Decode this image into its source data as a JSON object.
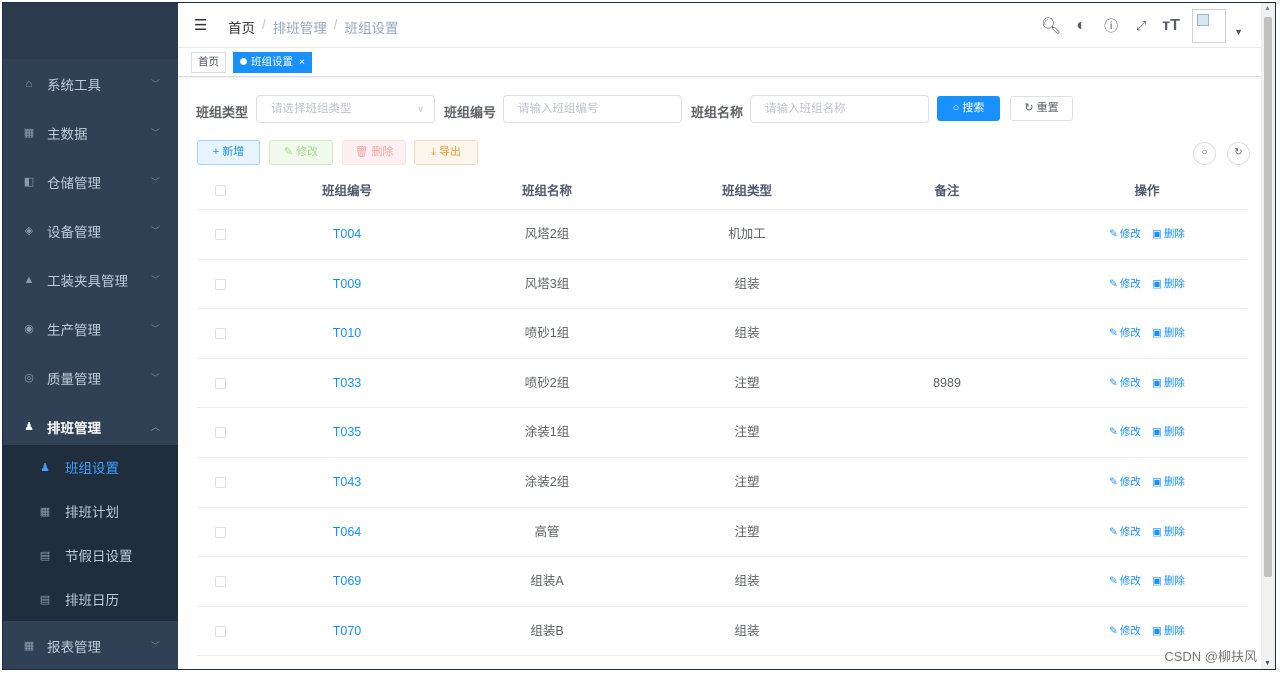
{
  "sidebar": {
    "items": [
      {
        "label": "系统工具",
        "icon": "toolbox-icon",
        "glyph": "⌂"
      },
      {
        "label": "主数据",
        "icon": "grid-icon",
        "glyph": "▦"
      },
      {
        "label": "仓储管理",
        "icon": "warehouse-icon",
        "glyph": "◧"
      },
      {
        "label": "设备管理",
        "icon": "layers-icon",
        "glyph": "◈"
      },
      {
        "label": "工装夹具管理",
        "icon": "lock-icon",
        "glyph": "▲"
      },
      {
        "label": "生产管理",
        "icon": "eye-icon",
        "glyph": "◉"
      },
      {
        "label": "质量管理",
        "icon": "quality-icon",
        "glyph": "◎"
      },
      {
        "label": "排班管理",
        "icon": "people-icon",
        "glyph": "♟"
      },
      {
        "label": "报表管理",
        "icon": "table-icon",
        "glyph": "▦"
      }
    ],
    "submenu": [
      {
        "label": "班组设置",
        "icon": "people-icon",
        "glyph": "♟"
      },
      {
        "label": "排班计划",
        "icon": "grid-icon",
        "glyph": "▦"
      },
      {
        "label": "节假日设置",
        "icon": "calendar-icon",
        "glyph": "▤"
      },
      {
        "label": "排班日历",
        "icon": "calendar-icon",
        "glyph": "▤"
      }
    ]
  },
  "header": {
    "breadcrumb": [
      "首页",
      "排班管理",
      "班组设置"
    ],
    "tools": [
      "search-icon",
      "github-icon",
      "question-icon",
      "fullscreen-icon",
      "font-size-icon"
    ]
  },
  "tags": {
    "home": "首页",
    "active": "班组设置",
    "close": "×"
  },
  "search": {
    "type_label": "班组类型",
    "type_placeholder": "请选择班组类型",
    "code_label": "班组编号",
    "code_placeholder": "请输入班组编号",
    "name_label": "班组名称",
    "name_placeholder": "请输入班组名称",
    "search_button": "搜索",
    "reset_button": "重置"
  },
  "toolbar": {
    "add": "新增",
    "edit": "修改",
    "delete": "删除",
    "export": "导出"
  },
  "table": {
    "columns": [
      "班组编号",
      "班组名称",
      "班组类型",
      "备注",
      "操作"
    ],
    "edit_label": "修改",
    "delete_label": "删除",
    "rows": [
      {
        "code": "T004",
        "name": "风塔2组",
        "type": "机加工",
        "remark": ""
      },
      {
        "code": "T009",
        "name": "风塔3组",
        "type": "组装",
        "remark": ""
      },
      {
        "code": "T010",
        "name": "喷砂1组",
        "type": "组装",
        "remark": ""
      },
      {
        "code": "T033",
        "name": "喷砂2组",
        "type": "注塑",
        "remark": "8989"
      },
      {
        "code": "T035",
        "name": "涂装1组",
        "type": "注塑",
        "remark": ""
      },
      {
        "code": "T043",
        "name": "涂装2组",
        "type": "注塑",
        "remark": ""
      },
      {
        "code": "T064",
        "name": "高管",
        "type": "注塑",
        "remark": ""
      },
      {
        "code": "T069",
        "name": "组装A",
        "type": "组装",
        "remark": ""
      },
      {
        "code": "T070",
        "name": "组装B",
        "type": "组装",
        "remark": ""
      }
    ]
  },
  "watermark": "CSDN @柳扶风",
  "colors": {
    "primary": "#1890ff",
    "sidebar": "#304156",
    "submenu": "#1f2d3d"
  }
}
